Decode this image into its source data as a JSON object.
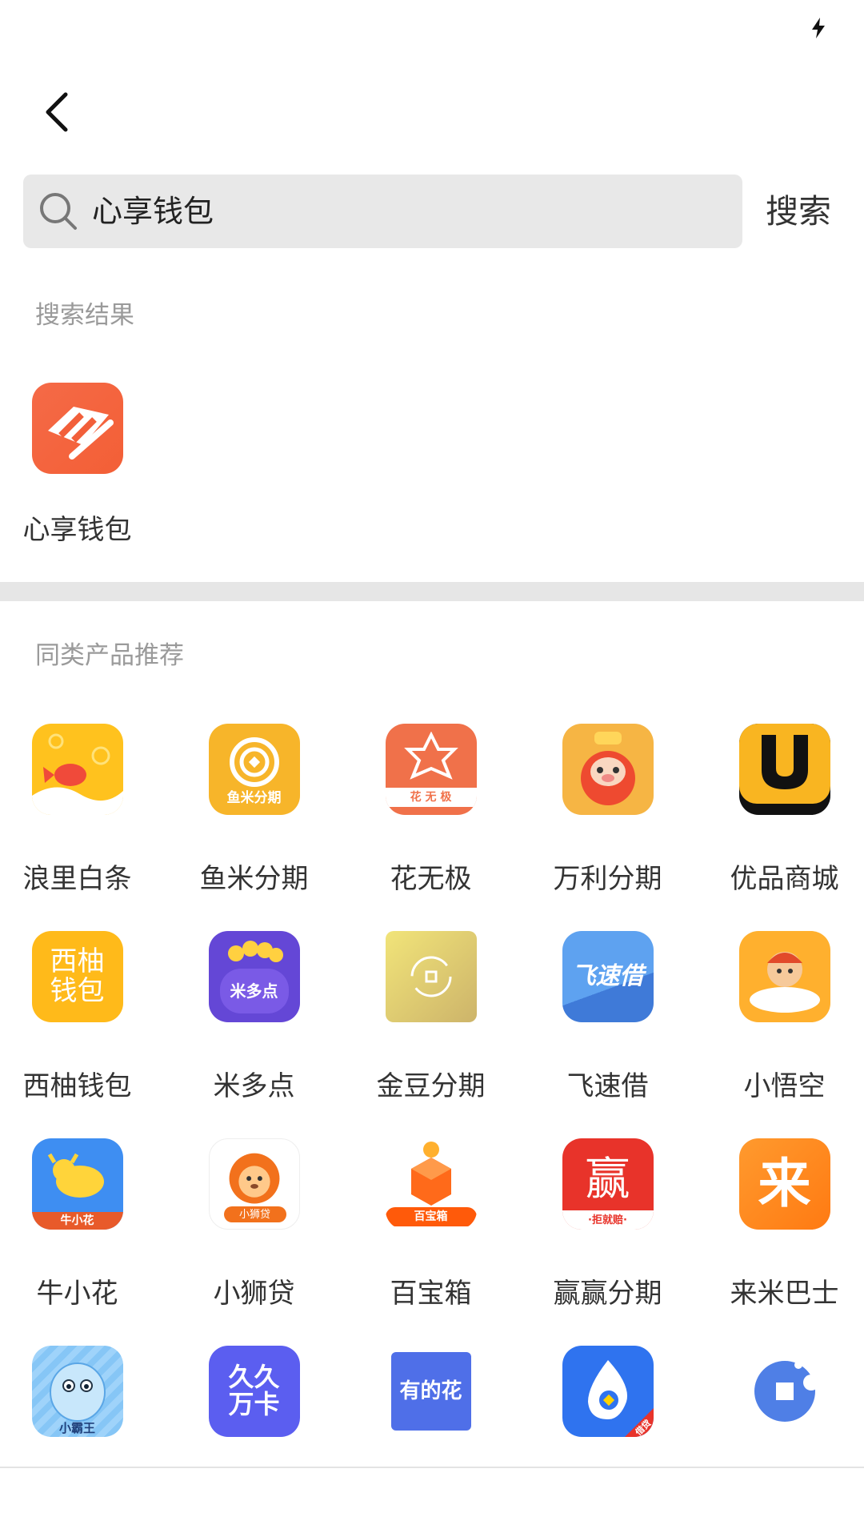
{
  "search": {
    "query": "心享钱包",
    "button_label": "搜索"
  },
  "result_section": {
    "title": "搜索结果",
    "app": {
      "name": "心享钱包",
      "color": "#f0603f"
    }
  },
  "recommend_section": {
    "title": "同类产品推荐",
    "apps": [
      {
        "name": "浪里白条",
        "color": "#ffc21e"
      },
      {
        "name": "鱼米分期",
        "color": "#f7b52a",
        "icon_text": "鱼米分期"
      },
      {
        "name": "花无极",
        "color": "#f0714a",
        "icon_text": "花 无 极"
      },
      {
        "name": "万利分期",
        "color": "#f6b544"
      },
      {
        "name": "优品商城",
        "color": "#f9b521"
      },
      {
        "name": "西柚钱包",
        "color": "#ffba1a",
        "icon_text": "西柚\n钱包"
      },
      {
        "name": "米多点",
        "color": "#6447d6",
        "icon_text": "米多点"
      },
      {
        "name": "金豆分期",
        "color": "#e7d173"
      },
      {
        "name": "飞速借",
        "color": "#4a8fe6",
        "icon_text": "飞速借"
      },
      {
        "name": "小悟空",
        "color": "#ffb02e"
      },
      {
        "name": "牛小花",
        "color": "#3e8ef2",
        "icon_text": "牛小花"
      },
      {
        "name": "小狮贷",
        "color": "#ffffff",
        "icon_text": "小狮贷"
      },
      {
        "name": "百宝箱",
        "color": "#ff6a1a",
        "icon_text": "百宝箱"
      },
      {
        "name": "赢赢分期",
        "color": "#e8332a",
        "icon_text": "赢",
        "icon_sub": "·拒就赔·"
      },
      {
        "name": "来米巴士",
        "color": "#ff8a1e",
        "icon_text": "来"
      },
      {
        "name": "",
        "color": "#6fb6f0",
        "icon_text": "小霸王"
      },
      {
        "name": "",
        "color": "#5b5ef0",
        "icon_text": "久久\n万卡"
      },
      {
        "name": "",
        "color": "#4f6fe8",
        "icon_text": "有的花"
      },
      {
        "name": "",
        "color": "#2f73ef",
        "icon_text": "借贷"
      },
      {
        "name": "",
        "color": "#4f7fe6"
      }
    ]
  }
}
